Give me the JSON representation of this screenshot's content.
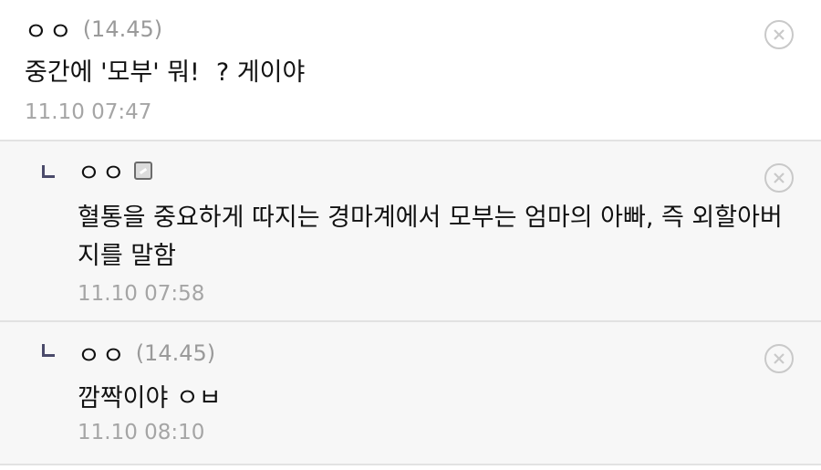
{
  "comments": [
    {
      "nick": "ㅇㅇ",
      "ip": "(14.45)",
      "text_before": "중간에 '모부' 뭐!",
      "text_after": "? 게이야",
      "time": "11.10 07:47"
    }
  ],
  "replies": [
    {
      "nick": "ㅇㅇ",
      "badge_icon": "writer-badge-icon",
      "line1": "혈통을 중요하게 따지는 경마계에서 모부는 엄마의 아빠, 즉 외할아버",
      "line2": "지를 말함",
      "time": "11.10 07:58"
    },
    {
      "nick": "ㅇㅇ",
      "ip": "(14.45)",
      "text": "깜짝이야 ㅇㅂ",
      "time": "11.10 08:10"
    }
  ],
  "colors": {
    "reply_bg": "#f7f7f7",
    "divider": "#e2e2e2",
    "meta_text": "#a5a5a5",
    "reply_arrow": "#4a4a6a"
  }
}
